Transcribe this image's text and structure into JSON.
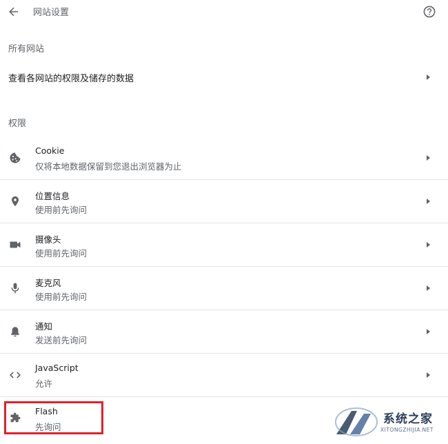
{
  "header": {
    "title": "网站设置",
    "back_icon": "arrow-back-icon",
    "help_icon": "help-circle-icon"
  },
  "all_sites": {
    "section_label": "所有网站",
    "view_label": "查看各网站的权限及储存的数据"
  },
  "permissions": {
    "section_label": "权限",
    "items": [
      {
        "title": "Cookie",
        "subtitle": "仅将本地数据保留到您退出浏览器为止",
        "icon": "cookie-icon"
      },
      {
        "title": "位置信息",
        "subtitle": "使用前先询问",
        "icon": "location-pin-icon"
      },
      {
        "title": "摄像头",
        "subtitle": "使用前先询问",
        "icon": "camera-icon"
      },
      {
        "title": "麦克风",
        "subtitle": "使用前先询问",
        "icon": "microphone-icon"
      },
      {
        "title": "通知",
        "subtitle": "发送前先询问",
        "icon": "bell-icon"
      },
      {
        "title": "JavaScript",
        "subtitle": "允许",
        "icon": "code-icon"
      },
      {
        "title": "Flash",
        "subtitle": "先询问",
        "icon": "puzzle-icon"
      }
    ]
  },
  "annotation": {
    "highlight_color": "#e0202a"
  },
  "watermark": {
    "text": "系统之家",
    "url": "XITONGZHIJIA.NET"
  }
}
